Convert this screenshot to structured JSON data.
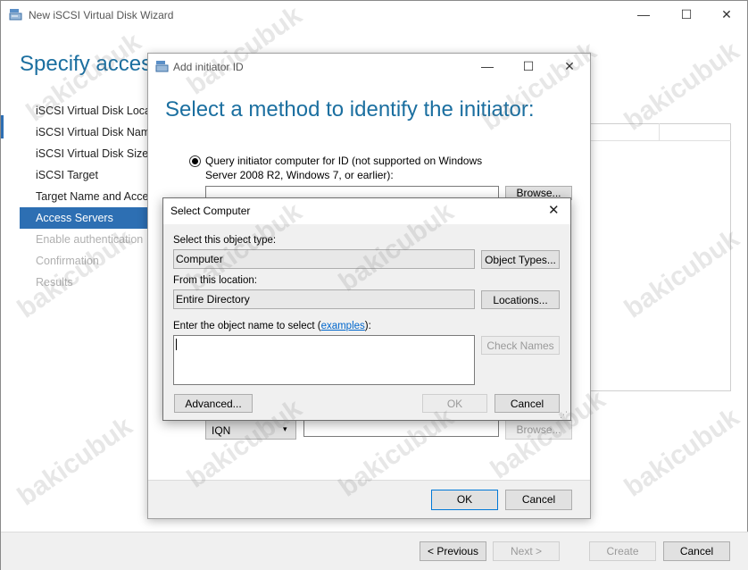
{
  "wizard": {
    "title": "New iSCSI Virtual Disk Wizard",
    "heading": "Specify access",
    "nav": [
      {
        "label": "iSCSI Virtual Disk Locat",
        "state": "normal"
      },
      {
        "label": "iSCSI Virtual Disk Name",
        "state": "normal"
      },
      {
        "label": "iSCSI Virtual Disk Size",
        "state": "normal"
      },
      {
        "label": "iSCSI Target",
        "state": "normal"
      },
      {
        "label": "Target Name and Acce",
        "state": "normal"
      },
      {
        "label": "Access Servers",
        "state": "selected"
      },
      {
        "label": "Enable authentication",
        "state": "disabled"
      },
      {
        "label": "Confirmation",
        "state": "disabled"
      },
      {
        "label": "Results",
        "state": "disabled"
      }
    ],
    "buttons": {
      "previous": "< Previous",
      "next": "Next >",
      "create": "Create",
      "cancel": "Cancel"
    },
    "caption": {
      "minimize": "—",
      "maximize": "☐",
      "close": "✕"
    }
  },
  "add_initiator": {
    "title": "Add initiator ID",
    "heading": "Select a method to identify the initiator:",
    "query_option": "Query initiator computer for ID (not supported on Windows Server 2008 R2, Windows 7, or earlier):",
    "browse_top": "Browse...",
    "type_select": "IQN",
    "browse_bottom": "Browse...",
    "ok": "OK",
    "cancel": "Cancel",
    "caption": {
      "minimize": "—",
      "maximize": "☐",
      "close": "✕"
    }
  },
  "select_computer": {
    "title": "Select Computer",
    "object_type_label": "Select this object type:",
    "object_type_value": "Computer",
    "object_types_button": "Object Types...",
    "location_label": "From this location:",
    "location_value": "Entire Directory",
    "locations_button": "Locations...",
    "enter_label_pre": "Enter the object name to select (",
    "enter_label_link": "examples",
    "enter_label_post": "):",
    "object_name_value": "",
    "check_names_button": "Check Names",
    "advanced_button": "Advanced...",
    "ok": "OK",
    "cancel": "Cancel",
    "close": "✕"
  },
  "watermark": "bakicubuk",
  "colors": {
    "accent": "#2d6fb3",
    "heading": "#1b6fa0",
    "link": "#0066cc"
  }
}
